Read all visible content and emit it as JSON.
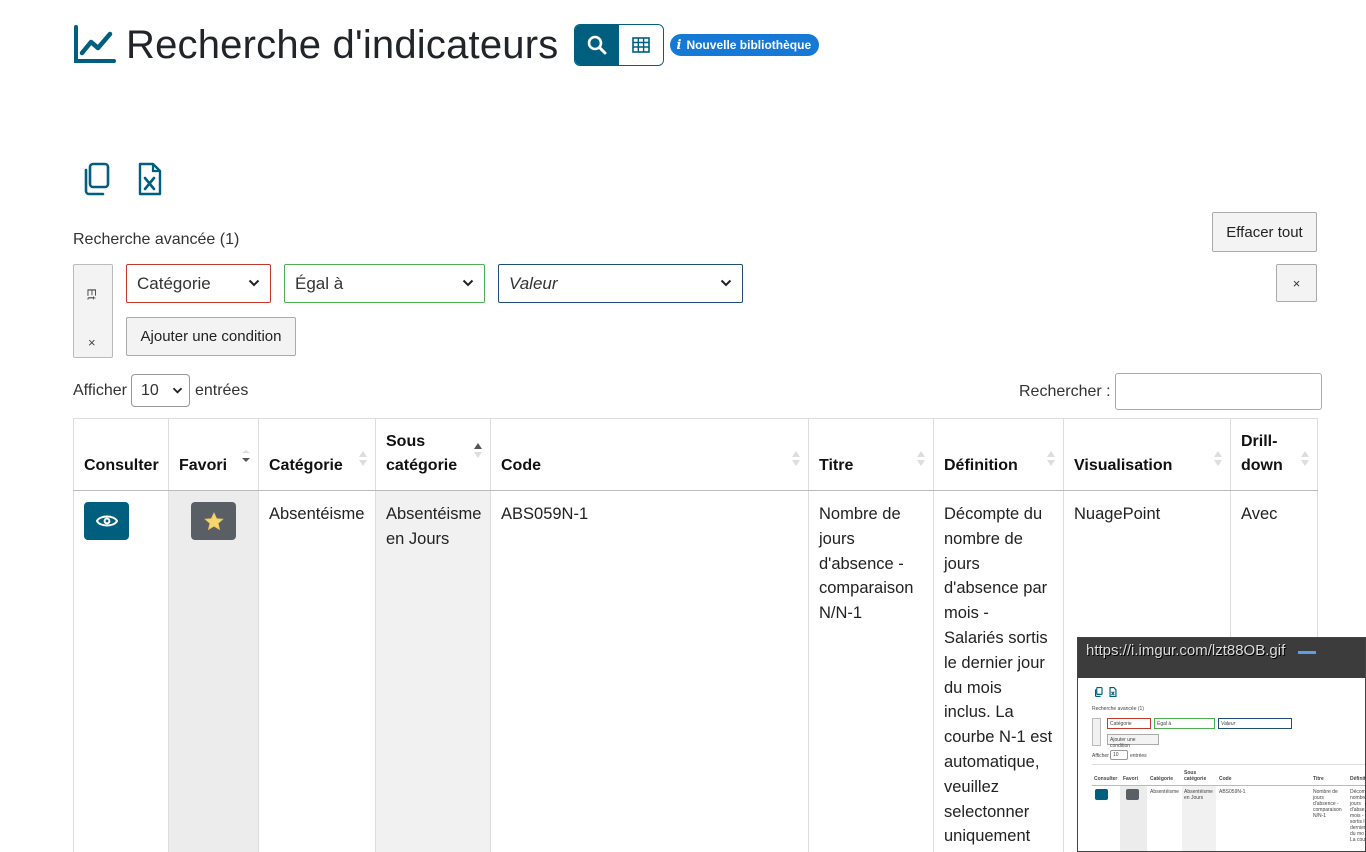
{
  "header": {
    "title": "Recherche d'indicateurs",
    "title_icon": "line-chart-icon",
    "view_search_icon": "search-icon",
    "view_grid_icon": "grid-table-icon",
    "badge_icon": "i",
    "badge_label": "Nouvelle bibliothèque"
  },
  "export": {
    "copy_icon": "copy-icon",
    "excel_icon": "excel-file-icon"
  },
  "advanced_search": {
    "label": "Recherche avancée (1)",
    "clear_all": "Effacer tout",
    "logic_label": "Et",
    "logic_remove": "×",
    "condition": {
      "field": "Catégorie",
      "operator": "Égal à",
      "value_placeholder": "Valeur",
      "remove": "×"
    },
    "add_condition": "Ajouter une condition"
  },
  "length_menu": {
    "prefix": "Afficher",
    "value": "10",
    "suffix": "entrées"
  },
  "search": {
    "label": "Rechercher :",
    "value": ""
  },
  "table": {
    "columns": [
      "Consulter",
      "Favori",
      "Catégorie",
      "Sous catégorie",
      "Code",
      "Titre",
      "Définition",
      "Visualisation",
      "Drill-down"
    ],
    "row": {
      "consult_icon": "eye-icon",
      "favorite_icon": "star-icon",
      "categorie": "Absentéisme",
      "sous_categorie": "Absentéisme en Jours",
      "code": "ABS059N-1",
      "titre": "Nombre de jours d'absence - comparaison N/N-1",
      "definition": "Décompte du nombre de jours d'absence par mois - Salariés sortis le dernier jour du mois inclus. La courbe N-1 est automatique, veuillez selectonner uniquement",
      "visualisation": "NuagePoint",
      "drilldown": "Avec"
    }
  },
  "preview": {
    "url": "https://i.imgur.com/lzt88OB.gif",
    "mini": {
      "adv": "Recherche avancée (1)",
      "cat": "Catégorie",
      "op": "Égal à",
      "val": "Valeur",
      "add": "Ajouter une condition",
      "afficher": "Afficher",
      "ten": "10",
      "entrees": "entrées",
      "h_consulter": "Consulter",
      "h_favori": "Favori",
      "h_categorie": "Catégorie",
      "h_sous": "Sous catégorie",
      "h_code": "Code",
      "h_titre": "Titre",
      "h_def": "Définit",
      "r_cat": "Absentéisme",
      "r_sous": "Absentéisme en Jours",
      "r_code": "ABS059N-1",
      "r_titre": "Nombre de jours d'absence - comparaison N/N-1",
      "r_def": "Décom nombre jours d'abse mois - sortis l dernier du mo La cou"
    }
  },
  "colors": {
    "primary": "#005f7f",
    "badge": "#1779d6",
    "star": "#f5d76e",
    "favori_btn": "#5a5f66"
  }
}
